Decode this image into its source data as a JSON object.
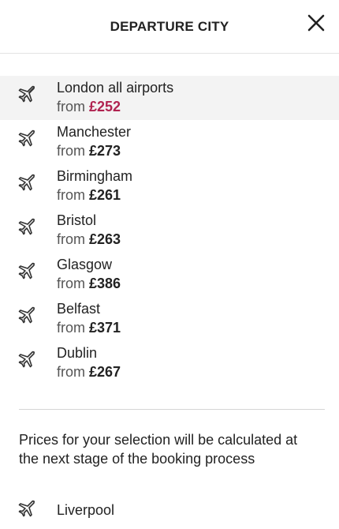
{
  "header": {
    "title": "DEPARTURE CITY",
    "close_icon": "close-icon"
  },
  "colors": {
    "accent_price": "#b02350",
    "selected_background": "#f3f3f3"
  },
  "cities": [
    {
      "name": "London all airports",
      "from_label": "from",
      "price": "£252",
      "selected": true
    },
    {
      "name": "Manchester",
      "from_label": "from",
      "price": "£273"
    },
    {
      "name": "Birmingham",
      "from_label": "from",
      "price": "£261"
    },
    {
      "name": "Bristol",
      "from_label": "from",
      "price": "£263"
    },
    {
      "name": "Glasgow",
      "from_label": "from",
      "price": "£386"
    },
    {
      "name": "Belfast",
      "from_label": "from",
      "price": "£371"
    },
    {
      "name": "Dublin",
      "from_label": "from",
      "price": "£267"
    }
  ],
  "note": "Prices for your selection will be calculated at the next stage of the booking process",
  "other_cities": [
    {
      "name": "Liverpool"
    }
  ]
}
